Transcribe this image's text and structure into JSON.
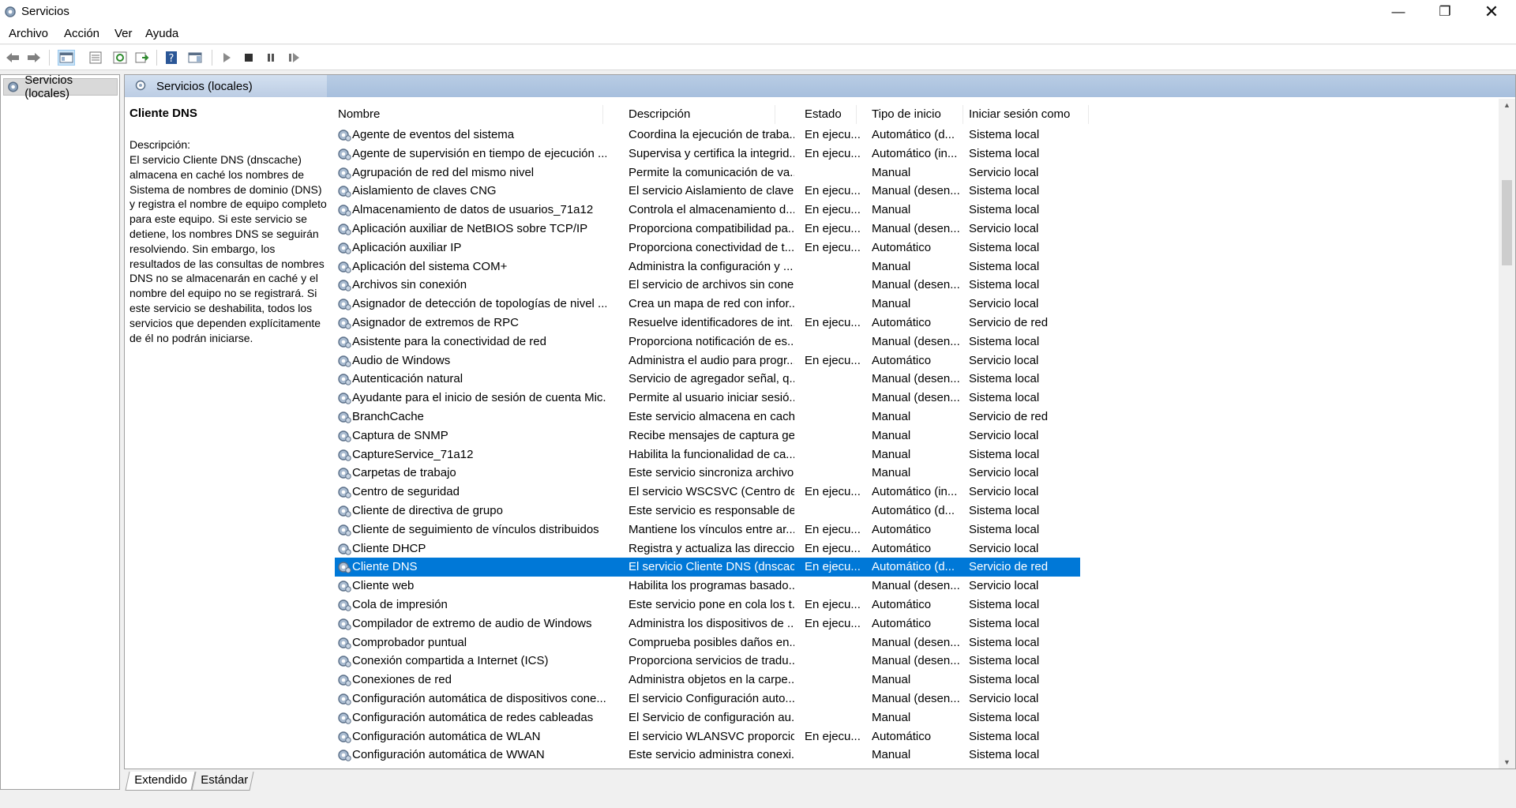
{
  "window": {
    "title": "Servicios"
  },
  "menu": [
    "Archivo",
    "Acción",
    "Ver",
    "Ayuda"
  ],
  "tree": {
    "root_label": "Servicios (locales)"
  },
  "panel": {
    "header": "Servicios (locales)"
  },
  "description": {
    "title": "Cliente DNS",
    "label": "Descripción:",
    "text": "El servicio Cliente DNS (dnscache) almacena en caché los nombres de Sistema de nombres de dominio (DNS) y registra el nombre de equipo completo para este equipo. Si este servicio se detiene, los nombres DNS se seguirán resolviendo. Sin embargo, los resultados de las consultas de nombres DNS no se almacenarán en caché y el nombre del equipo no se registrará. Si este servicio se deshabilita, todos los servicios que dependen explícitamente de él no podrán iniciarse."
  },
  "table": {
    "columns": [
      "Nombre",
      "Descripción",
      "Estado",
      "Tipo de inicio",
      "Iniciar sesión como"
    ],
    "selected_index": 23,
    "rows": [
      [
        "Agente de eventos del sistema",
        "Coordina la ejecución de traba...",
        "En ejecu...",
        "Automático (d...",
        "Sistema local"
      ],
      [
        "Agente de supervisión en tiempo de ejecución ...",
        "Supervisa y certifica la integrid...",
        "En ejecu...",
        "Automático (in...",
        "Sistema local"
      ],
      [
        "Agrupación de red del mismo nivel",
        "Permite la comunicación de va...",
        "",
        "Manual",
        "Servicio local"
      ],
      [
        "Aislamiento de claves CNG",
        "El servicio Aislamiento de clave...",
        "En ejecu...",
        "Manual (desen...",
        "Sistema local"
      ],
      [
        "Almacenamiento de datos de usuarios_71a12",
        "Controla el almacenamiento d...",
        "En ejecu...",
        "Manual",
        "Sistema local"
      ],
      [
        "Aplicación auxiliar de NetBIOS sobre TCP/IP",
        "Proporciona compatibilidad pa...",
        "En ejecu...",
        "Manual (desen...",
        "Servicio local"
      ],
      [
        "Aplicación auxiliar IP",
        "Proporciona conectividad de t...",
        "En ejecu...",
        "Automático",
        "Sistema local"
      ],
      [
        "Aplicación del sistema COM+",
        "Administra la configuración y ...",
        "",
        "Manual",
        "Sistema local"
      ],
      [
        "Archivos sin conexión",
        "El servicio de archivos sin cone...",
        "",
        "Manual (desen...",
        "Sistema local"
      ],
      [
        "Asignador de detección de topologías de nivel ...",
        "Crea un mapa de red con infor...",
        "",
        "Manual",
        "Servicio local"
      ],
      [
        "Asignador de extremos de RPC",
        "Resuelve identificadores de int...",
        "En ejecu...",
        "Automático",
        "Servicio de red"
      ],
      [
        "Asistente para la conectividad de red",
        "Proporciona notificación de es...",
        "",
        "Manual (desen...",
        "Sistema local"
      ],
      [
        "Audio de Windows",
        "Administra el audio para progr...",
        "En ejecu...",
        "Automático",
        "Servicio local"
      ],
      [
        "Autenticación natural",
        "Servicio de agregador señal, q...",
        "",
        "Manual (desen...",
        "Sistema local"
      ],
      [
        "Ayudante para el inicio de sesión de cuenta Mic...",
        "Permite al usuario iniciar sesió...",
        "",
        "Manual (desen...",
        "Sistema local"
      ],
      [
        "BranchCache",
        "Este servicio almacena en cach...",
        "",
        "Manual",
        "Servicio de red"
      ],
      [
        "Captura de SNMP",
        "Recibe mensajes de captura ge...",
        "",
        "Manual",
        "Servicio local"
      ],
      [
        "CaptureService_71a12",
        "Habilita la funcionalidad de ca...",
        "",
        "Manual",
        "Sistema local"
      ],
      [
        "Carpetas de trabajo",
        "Este servicio sincroniza archivo...",
        "",
        "Manual",
        "Servicio local"
      ],
      [
        "Centro de seguridad",
        "El servicio WSCSVC (Centro de ...",
        "En ejecu...",
        "Automático (in...",
        "Servicio local"
      ],
      [
        "Cliente de directiva de grupo",
        "Este servicio es responsable de...",
        "",
        "Automático (d...",
        "Sistema local"
      ],
      [
        "Cliente de seguimiento de vínculos distribuidos",
        "Mantiene los vínculos entre ar...",
        "En ejecu...",
        "Automático",
        "Sistema local"
      ],
      [
        "Cliente DHCP",
        "Registra y actualiza las direccio...",
        "En ejecu...",
        "Automático",
        "Servicio local"
      ],
      [
        "Cliente DNS",
        "El servicio Cliente DNS (dnscac...",
        "En ejecu...",
        "Automático (d...",
        "Servicio de red"
      ],
      [
        "Cliente web",
        "Habilita los programas basado...",
        "",
        "Manual (desen...",
        "Servicio local"
      ],
      [
        "Cola de impresión",
        "Este servicio pone en cola los t...",
        "En ejecu...",
        "Automático",
        "Sistema local"
      ],
      [
        "Compilador de extremo de audio de Windows",
        "Administra los dispositivos de ...",
        "En ejecu...",
        "Automático",
        "Sistema local"
      ],
      [
        "Comprobador puntual",
        "Comprueba posibles daños en...",
        "",
        "Manual (desen...",
        "Sistema local"
      ],
      [
        "Conexión compartida a Internet (ICS)",
        "Proporciona servicios de tradu...",
        "",
        "Manual (desen...",
        "Sistema local"
      ],
      [
        "Conexiones de red",
        "Administra objetos en la carpe...",
        "",
        "Manual",
        "Sistema local"
      ],
      [
        "Configuración automática de dispositivos cone...",
        "El servicio Configuración auto...",
        "",
        "Manual (desen...",
        "Servicio local"
      ],
      [
        "Configuración automática de redes cableadas",
        "El Servicio de configuración au...",
        "",
        "Manual",
        "Sistema local"
      ],
      [
        "Configuración automática de WLAN",
        "El servicio WLANSVC proporcio...",
        "En ejecu...",
        "Automático",
        "Sistema local"
      ],
      [
        "Configuración automática de WWAN",
        "Este servicio administra conexi...",
        "",
        "Manual",
        "Sistema local"
      ]
    ]
  },
  "bottom_tabs": [
    "Extendido",
    "Estándar"
  ],
  "colors": {
    "selection": "#0078d7",
    "header_bar": "#a7bfdd"
  }
}
